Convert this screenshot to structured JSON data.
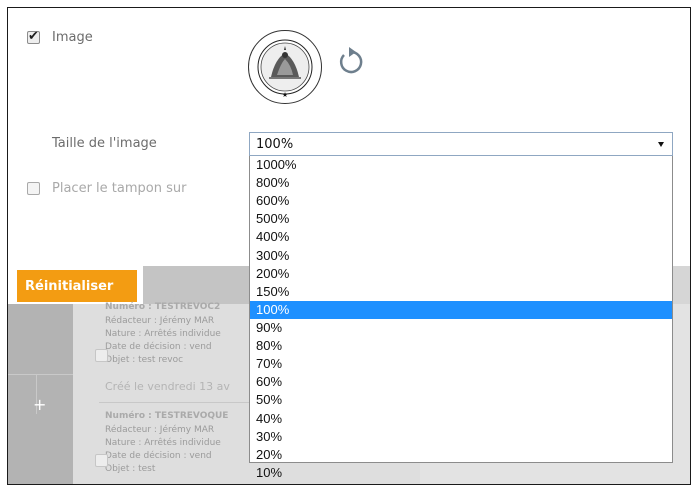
{
  "image_option": {
    "label": "Image",
    "checked": true
  },
  "stamp_icon": "seal-stamp-icon",
  "size_field": {
    "label": "Taille de l'image",
    "value": "100%",
    "options": [
      "1000%",
      "800%",
      "600%",
      "500%",
      "400%",
      "300%",
      "200%",
      "150%",
      "100%",
      "90%",
      "80%",
      "70%",
      "60%",
      "50%",
      "40%",
      "30%",
      "20%",
      "10%"
    ],
    "selected_index": 8
  },
  "place_stamp": {
    "label": "Placer le tampon sur",
    "checked": false
  },
  "reset_button": {
    "label": "Réinitialiser"
  },
  "side_strip": {
    "plus_label": "+"
  },
  "records": [
    {
      "numero": "Numéro : TESTREVOC2",
      "redacteur": "Rédacteur : Jérémy MAR",
      "nature": "Nature : Arrêtés individue",
      "date": "Date de décision : vend",
      "objet": "Objet : test revoc",
      "created": "Créé le vendredi 13 av"
    },
    {
      "numero": "Numéro : TESTREVOQUE",
      "redacteur": "Rédacteur : Jérémy MAR",
      "nature": "Nature : Arrêtés individue",
      "date": "Date de décision : vend",
      "objet": "Objet : test"
    }
  ],
  "colors": {
    "accent": "#f39c12",
    "selection": "#1e90ff"
  }
}
